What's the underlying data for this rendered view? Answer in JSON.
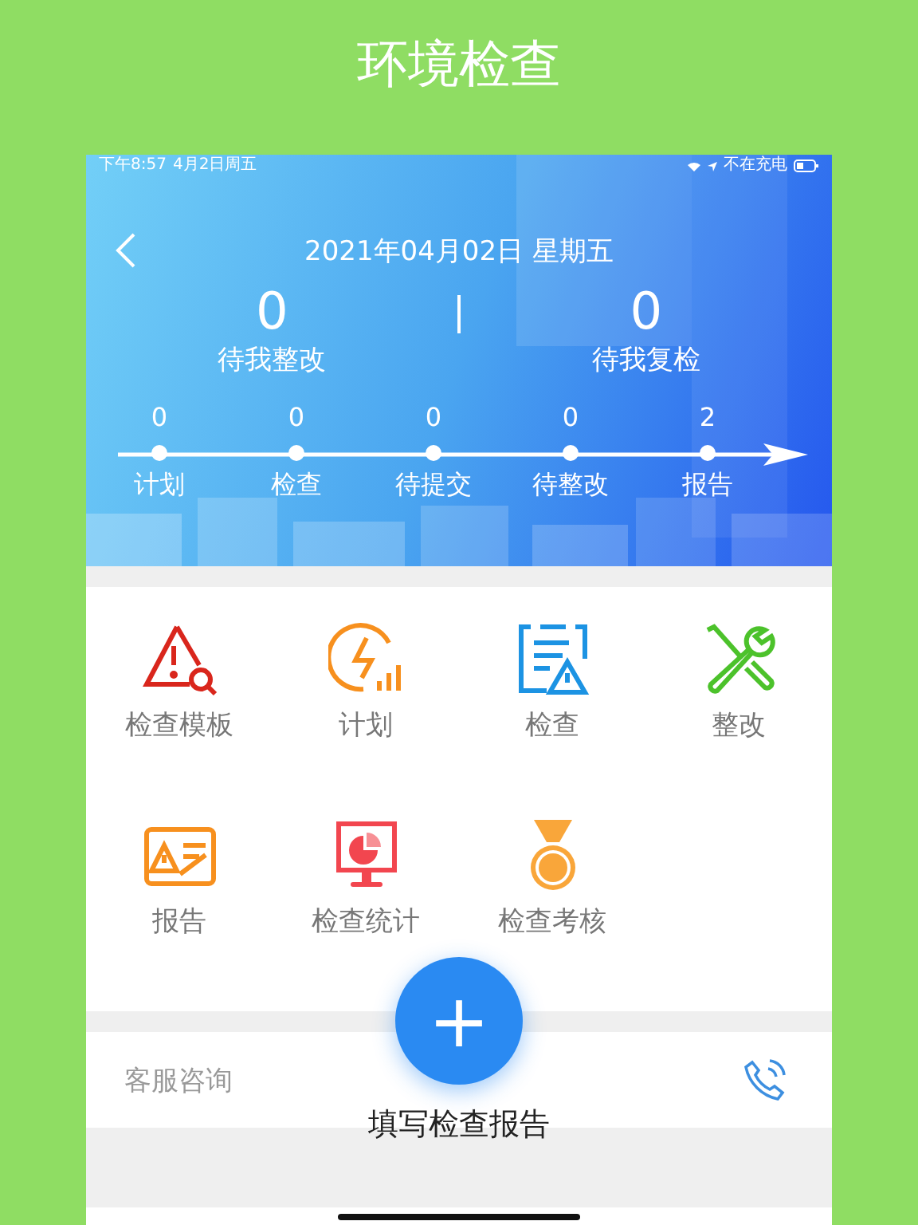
{
  "page_title": "环境检查",
  "status_bar": {
    "time": "下午8:57",
    "date": "4月2日周五",
    "charging": "不在充电"
  },
  "header": {
    "date": "2021年04月02日 星期五"
  },
  "summary": [
    {
      "count": "0",
      "label": "待我整改"
    },
    {
      "count": "0",
      "label": "待我复检"
    }
  ],
  "timeline": [
    {
      "count": "0",
      "label": "计划"
    },
    {
      "count": "0",
      "label": "检查"
    },
    {
      "count": "0",
      "label": "待提交"
    },
    {
      "count": "0",
      "label": "待整改"
    },
    {
      "count": "2",
      "label": "报告"
    }
  ],
  "menu": [
    {
      "kind": "warning-search",
      "label": "检查模板",
      "color": "#d9261c"
    },
    {
      "kind": "bolt",
      "label": "计划",
      "color": "#f7901e"
    },
    {
      "kind": "doc-warning",
      "label": "检查",
      "color": "#1c93e3"
    },
    {
      "kind": "tools",
      "label": "整改",
      "color": "#4cc22b"
    },
    {
      "kind": "report",
      "label": "报告",
      "color": "#f7901e"
    },
    {
      "kind": "monitor",
      "label": "检查统计",
      "color": "#f2464f"
    },
    {
      "kind": "medal",
      "label": "检查考核",
      "color": "#f9a63a"
    }
  ],
  "service": {
    "label": "客服咨询"
  },
  "fab": {
    "symbol": "+",
    "label": "填写检查报告"
  }
}
